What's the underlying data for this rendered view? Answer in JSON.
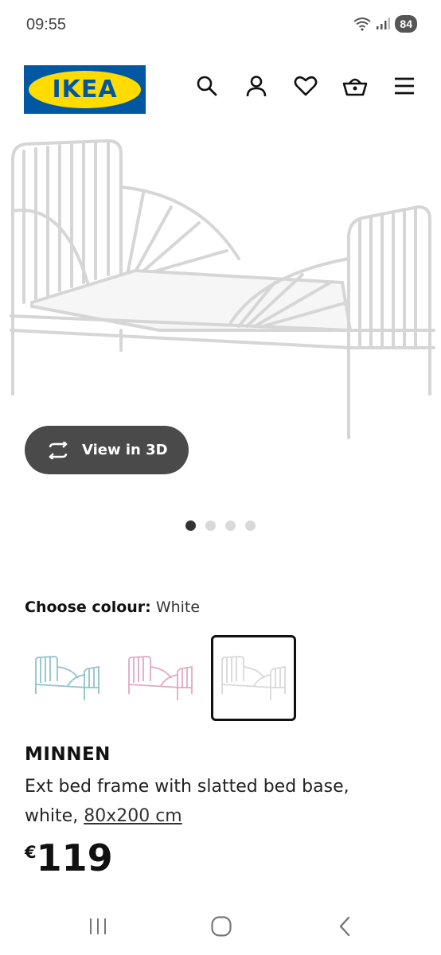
{
  "status_bar": {
    "time": "09:55",
    "battery": "84"
  },
  "header": {
    "logo_text": "IKEA",
    "icons": [
      "search-icon",
      "account-icon",
      "heart-icon",
      "basket-icon",
      "menu-icon"
    ]
  },
  "gallery": {
    "view3d_label": "View in 3D",
    "page_count": 4,
    "active_page": 1
  },
  "colour": {
    "label": "Choose colour:",
    "value": "White",
    "options": [
      {
        "name": "light-blue",
        "color": "#8fc3c9"
      },
      {
        "name": "light-pink",
        "color": "#e2a9c0"
      },
      {
        "name": "white",
        "color": "#e8e8e8"
      }
    ],
    "selected_index": 2
  },
  "product": {
    "name": "MINNEN",
    "description": "Ext bed frame with slatted bed base, white,",
    "size": "80x200 cm",
    "currency": "€",
    "price": "119"
  },
  "colors": {
    "brand_blue": "#0058a3",
    "brand_yellow": "#ffdb00",
    "pill_bg": "#4a4a4a"
  }
}
